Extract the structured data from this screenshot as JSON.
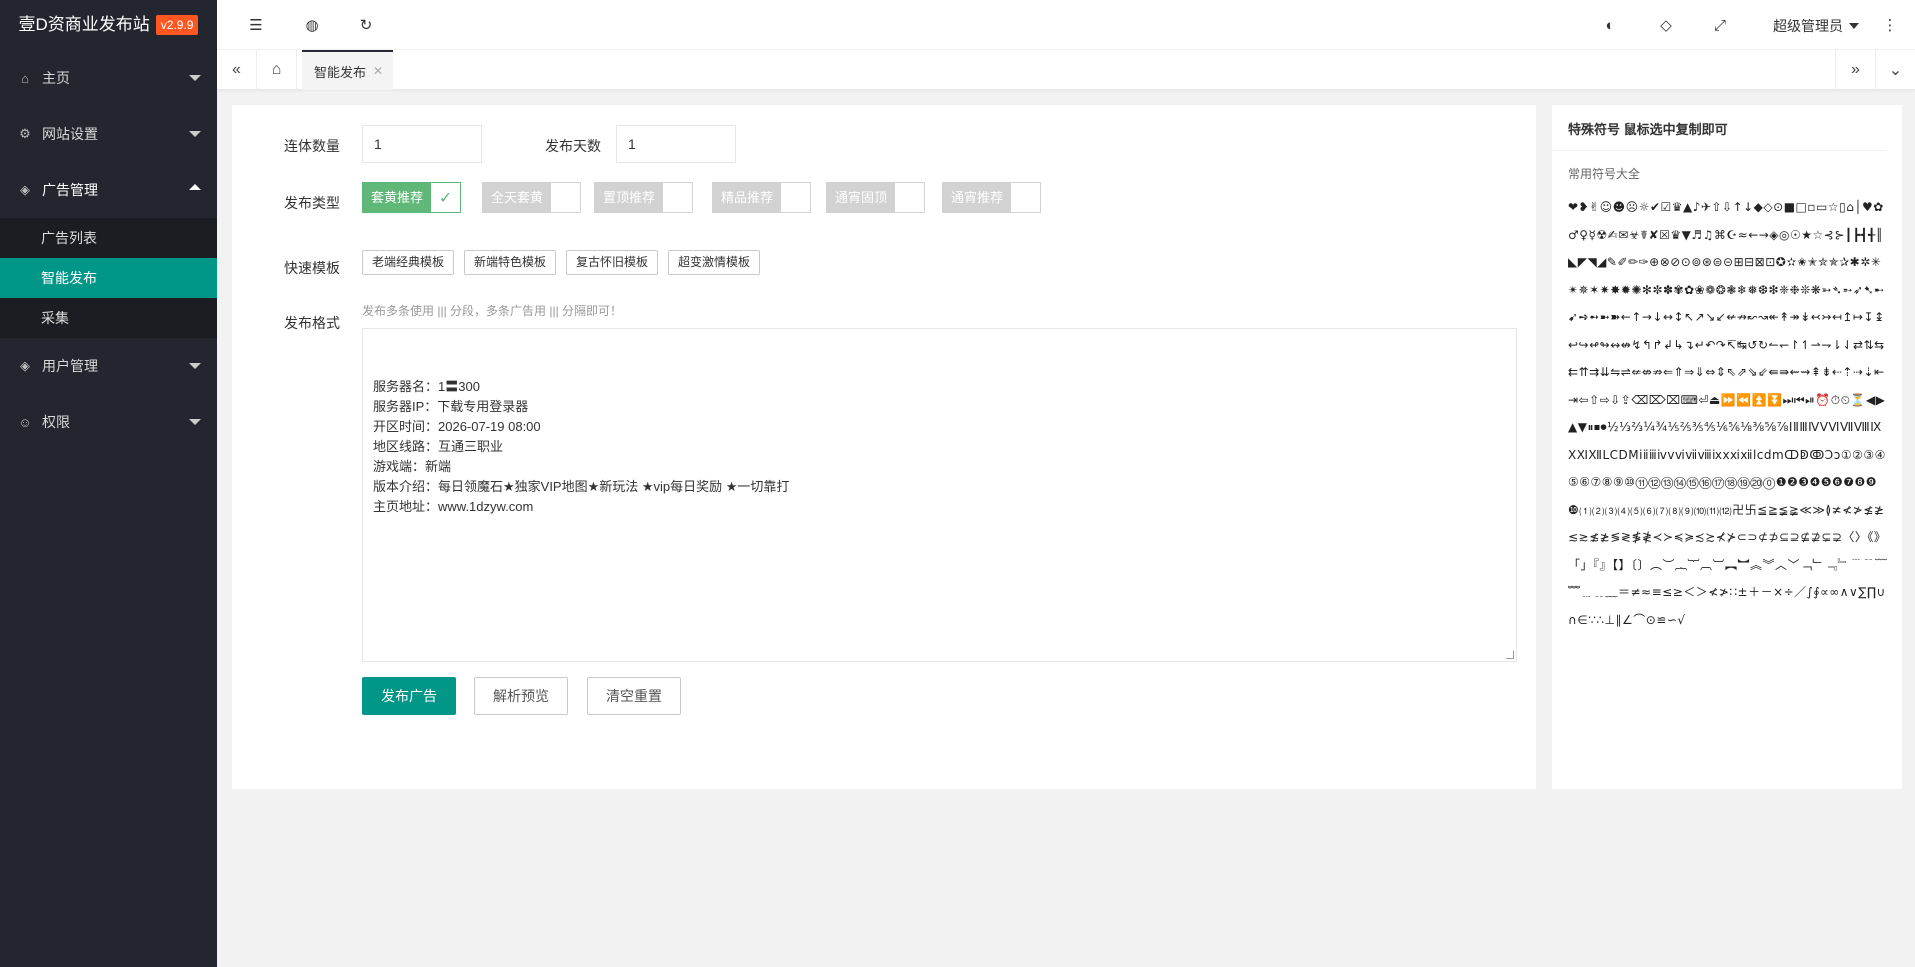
{
  "app": {
    "title": "壹D资商业发布站",
    "version": "v2.9.9"
  },
  "sidebar": {
    "items": [
      {
        "label": "主页"
      },
      {
        "label": "网站设置"
      },
      {
        "label": "广告管理"
      },
      {
        "label": "用户管理"
      },
      {
        "label": "权限"
      }
    ],
    "ads_sub": [
      {
        "label": "广告列表"
      },
      {
        "label": "智能发布"
      },
      {
        "label": "采集"
      }
    ]
  },
  "header": {
    "user": "超级管理员"
  },
  "tabs": [
    {
      "label": "智能发布"
    }
  ],
  "form": {
    "count_label": "连体数量",
    "count_value": "1",
    "days_label": "发布天数",
    "days_value": "1",
    "type_label": "发布类型",
    "types": [
      {
        "label": "套黄推荐",
        "on": true
      },
      {
        "label": "全天套黄",
        "on": false
      },
      {
        "label": "置顶推荐",
        "on": false
      },
      {
        "label": "精品推荐",
        "on": false
      },
      {
        "label": "通宵固顶",
        "on": false
      },
      {
        "label": "通宵推荐",
        "on": false
      }
    ],
    "template_label": "快速模板",
    "templates": [
      "老端经典模板",
      "新端特色模板",
      "复古怀旧模板",
      "超变激情模板"
    ],
    "format_label": "发布格式",
    "format_hint": "发布多条使用 ||| 分段，多条广告用 ||| 分隔即可！",
    "format_text": "服务器名：1〓300\n服务器IP：下载专用登录器\n开区时间：2026-07-19 08:00\n地区线路：互通三职业\n游戏端：新端\n版本介绍：每日领魔石★独家VIP地图★新玩法 ★vip每日奖励 ★一切靠打\n主页地址：www.1dzyw.com",
    "publish_btn": "发布广告",
    "preview_btn": "解析预览",
    "reset_btn": "清空重置"
  },
  "symbols": {
    "title": "特殊符号 鼠标选中复制即可",
    "subtitle": "常用符号大全",
    "content": "❤❥✌☺☻☹☼✔☑♛▲♪✈⇧⇩↑↓◆◇⊙■□▫▭☆▯⌂│♥✿♂♀☿☢✍✉☣☤✘☒♛▼♬♫⌘☪≈←→◈◎☉★☆⊰⊱┃┣┫╉║◣◤◥◢✎✐✏✑⊕⊗⊘⊙⊚⊛⊜⊝⊞⊟⊠⊡✪✫✬✭✮✯✰✱✲✳✴✵✶✷✸✹✺✻✼✽✾✿❀❁❂❃❄❅❆❇❈❉❊❋➳➴➵➶➷➸➹➺➻➼➽←↑→↓↔↕↖↗↘↙↚↛↜↝↞↟↠↡↢↣↤↥↦↧↨↩↪↫↬↭↮↯↰↱↲↳↴↵↶↷↸↹↺↻↼↽↾↿⇀⇁⇂⇃⇄⇅⇆⇇⇈⇉⇊⇋⇌⇍⇎⇏⇐⇑⇒⇓⇔⇕⇖⇗⇘⇙⇚⇛⇜⇝⇞⇟⇠⇡⇢⇣⇤⇥⇦⇧⇨⇩⇪⌫⌦⌧⌨⏎⏏⏩⏪⏫⏬⏭⏮⏯⏰⏱⏲⏳◀▶▲▼⏸⏹⏺½⅓⅔¼¾⅕⅖⅗⅘⅙⅚⅛⅜⅝⅞ⅠⅡⅢⅣⅤⅥⅦⅧⅨⅩⅪⅫⅬⅭⅮⅯⅰⅱⅲⅳⅴⅵⅶⅷⅸⅹⅺⅻⅼⅽⅾⅿↀↁↂↃↄ①②③④⑤⑥⑦⑧⑨⑩⑪⑫⑬⑭⑮⑯⑰⑱⑲⑳⓪❶❷❸❹❺❻❼❽❾❿⑴⑵⑶⑷⑸⑹⑺⑻⑼⑽⑾⑿卍卐≦≧≨≩≪≫≬≭≮≯≰≱≲≳≴≵≶≷≸≹≺≻≼≽≾≿⊀⊁⊂⊃⊄⊅⊆⊇⊈⊉⊊⊋〈〉《》「」『』【】〔〕︵︶︷︸︹︺︻︼︽︾︿﹀﹁﹂﹃﹄﹉﹊﹋﹌﹍﹎﹏＝≠≈≡≤≥＜＞≮≯∷±＋－×÷／∫∮∝∞∧∨∑∏∪∩∈∵∴⊥∥∠⌒⊙≌∽√"
  }
}
